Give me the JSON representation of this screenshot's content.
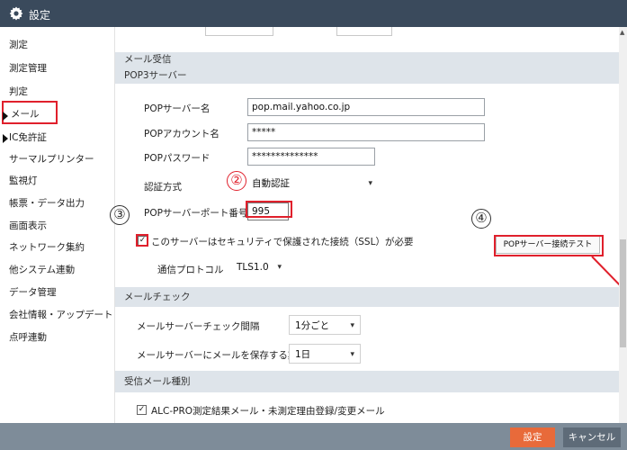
{
  "window": {
    "title": "設定",
    "icon": "gear-icon"
  },
  "sidebar": {
    "items": [
      {
        "label": "測定"
      },
      {
        "label": "測定管理"
      },
      {
        "label": "判定"
      },
      {
        "label": "メール",
        "selected": true
      },
      {
        "label": "IC免許証"
      },
      {
        "label": "サーマルプリンター"
      },
      {
        "label": "監視灯"
      },
      {
        "label": "帳票・データ出力"
      },
      {
        "label": "画面表示"
      },
      {
        "label": "ネットワーク集約"
      },
      {
        "label": "他システム連動"
      },
      {
        "label": "データ管理"
      },
      {
        "label": "会社情報・アップデート"
      },
      {
        "label": "点呼連動"
      }
    ]
  },
  "mail_receive": {
    "section_title": "メール受信",
    "pop3_title": "POP3サーバー",
    "server_label": "POPサーバー名",
    "server_value": "pop.mail.yahoo.co.jp",
    "account_label": "POPアカウント名",
    "account_value": "*****",
    "password_label": "POPパスワード",
    "password_value": "**************",
    "auth_label": "認証方式",
    "auth_value": "自動認証",
    "port_label": "POPサーバーポート番号",
    "port_value": "995",
    "ssl_label": "このサーバーはセキュリティで保護された接続（SSL）が必要",
    "ssl_checked": true,
    "protocol_label": "通信プロトコル",
    "protocol_value": "TLS1.0",
    "test_button": "POPサーバー接続テスト"
  },
  "mail_check": {
    "section_title": "メールチェック",
    "interval_label": "メールサーバーチェック間隔",
    "interval_value": "1分ごと",
    "keep_label": "メールサーバーにメールを保存する期間",
    "keep_value": "1日"
  },
  "received_types": {
    "section_title": "受信メール種別",
    "item_label": "ALC-PRO測定結果メール・未測定理由登録/変更メール",
    "item_checked": true
  },
  "footer": {
    "ok_label": "設定",
    "cancel_label": "キャンセル"
  },
  "annotations": {
    "n2": "②",
    "n3": "③",
    "n4": "④"
  },
  "glyphs": {
    "caret": "▾",
    "check": "✓",
    "scroll_up": "▲"
  },
  "colors": {
    "titlebar": "#3a4a5c",
    "highlight_red": "#e0202c",
    "ok_button": "#e86a3a",
    "footer": "#7e8c99"
  }
}
